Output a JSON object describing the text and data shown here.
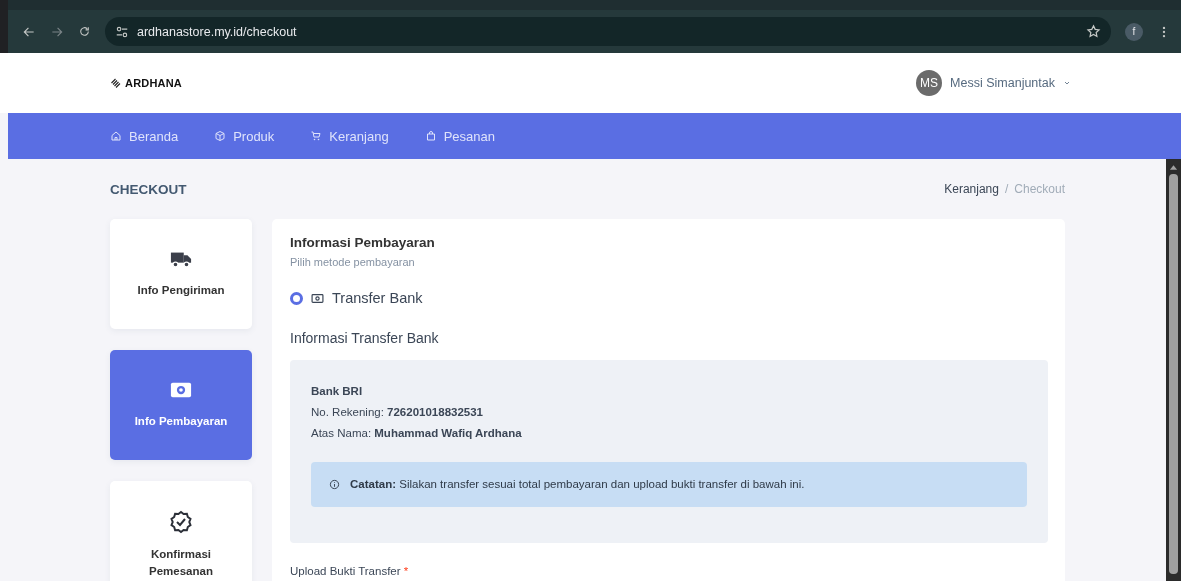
{
  "browser": {
    "url": "ardhanastore.my.id/checkout",
    "profile": "f"
  },
  "header": {
    "logo": "ARDHANA",
    "avatar": "MS",
    "user_name": "Messi Simanjuntak"
  },
  "nav": [
    {
      "label": "Beranda",
      "kind": "home"
    },
    {
      "label": "Produk",
      "kind": "box"
    },
    {
      "label": "Keranjang",
      "kind": "cart"
    },
    {
      "label": "Pesanan",
      "kind": "bag"
    }
  ],
  "page_title": "CHECKOUT",
  "breadcrumb_separator": "/",
  "breadcrumb": [
    {
      "label": "Keranjang",
      "selected": false
    },
    {
      "label": "Checkout",
      "selected": true
    }
  ],
  "steps": [
    {
      "label": "Info Pengiriman",
      "kind": "truck",
      "selected": false
    },
    {
      "label": "Info Pembayaran",
      "kind": "money",
      "selected": true
    },
    {
      "label": "Konfirmasi Pemesanan",
      "kind": "badge",
      "selected": false
    }
  ],
  "payment": {
    "title": "Informasi Pembayaran",
    "subtitle": "Pilih metode pembayaran",
    "options": [
      {
        "label": "Transfer Bank",
        "selected": true
      }
    ],
    "bank_title": "Informasi Transfer Bank",
    "bank": {
      "name": "Bank BRI",
      "account": "No. Rekening: **726201018832531**",
      "holder": "Atas Nama: **Muhammad Wafiq Ardhana**"
    },
    "note": "**Catatan:** Silakan transfer sesuai total pembayaran dan upload bukti transfer di bawah ini.",
    "upload_label": "Upload Bukti Transfer",
    "upload_required_mark": "*"
  }
}
